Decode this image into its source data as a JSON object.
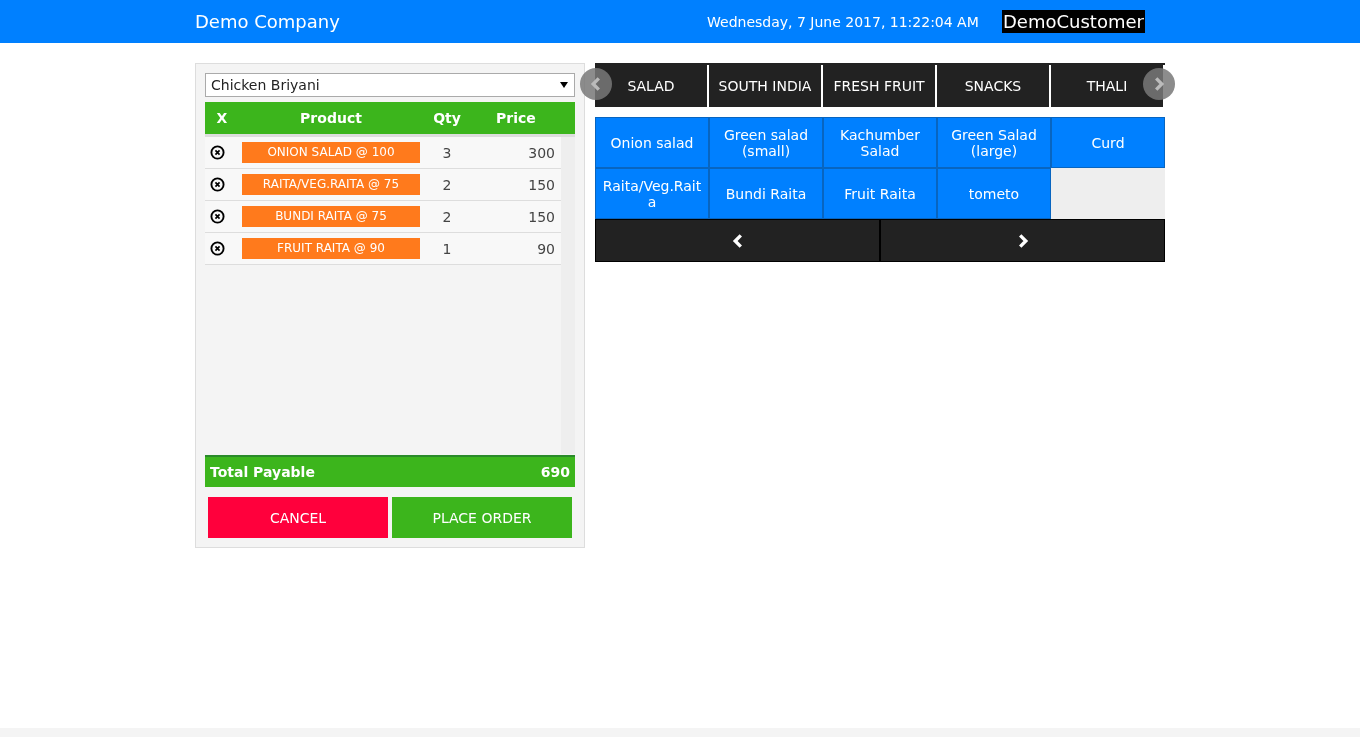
{
  "header": {
    "company": "Demo Company",
    "datetime": "Wednesday, 7 June 2017, 11:22:04 AM",
    "customer": "DemoCustomer"
  },
  "order": {
    "customer_select": {
      "value": "Chicken Briyani"
    },
    "columns": [
      "X",
      "Product",
      "Qty",
      "Price"
    ],
    "rows": [
      {
        "product": "ONION SALAD @ 100",
        "qty": "3",
        "price": "300"
      },
      {
        "product": "RAITA/VEG.RAITA @ 75",
        "qty": "2",
        "price": "150"
      },
      {
        "product": "BUNDI RAITA @ 75",
        "qty": "2",
        "price": "150"
      },
      {
        "product": "FRUIT RAITA @ 90",
        "qty": "1",
        "price": "90"
      }
    ],
    "total_label": "Total Payable",
    "total": "690",
    "buttons": [
      {
        "label": "CANCEL",
        "kind": "cancel"
      },
      {
        "label": "PLACE ORDER",
        "kind": "confirm"
      }
    ]
  },
  "categories": [
    {
      "label": "SALAD"
    },
    {
      "label": "SOUTH INDIA"
    },
    {
      "label": "FRESH FRUIT"
    },
    {
      "label": "SNACKS"
    },
    {
      "label": "THALI"
    }
  ],
  "products": [
    {
      "label": "Onion salad"
    },
    {
      "label": "Green salad (small)"
    },
    {
      "label": "Kachumber Salad"
    },
    {
      "label": "Green Salad (large)"
    },
    {
      "label": "Curd"
    },
    {
      "label": "Raita/Veg.Raita"
    },
    {
      "label": "Bundi Raita"
    },
    {
      "label": "Fruit Raita"
    },
    {
      "label": "tometo"
    }
  ]
}
